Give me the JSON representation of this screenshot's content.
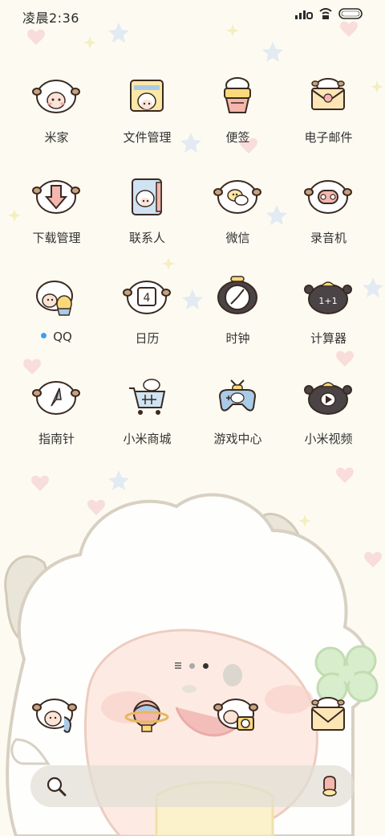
{
  "status_bar": {
    "time": "凌晨2:36",
    "icons": [
      "signal-icon",
      "hd-icon",
      "wifi-icon",
      "battery-icon"
    ]
  },
  "home_grid": {
    "apps": [
      {
        "label": "米家",
        "icon": "mi-home-icon"
      },
      {
        "label": "文件管理",
        "icon": "file-manager-icon"
      },
      {
        "label": "便签",
        "icon": "notes-icon"
      },
      {
        "label": "电子邮件",
        "icon": "email-icon"
      },
      {
        "label": "下载管理",
        "icon": "download-manager-icon"
      },
      {
        "label": "联系人",
        "icon": "contacts-icon"
      },
      {
        "label": "微信",
        "icon": "wechat-icon"
      },
      {
        "label": "录音机",
        "icon": "recorder-icon"
      },
      {
        "label": "QQ",
        "icon": "qq-icon",
        "new_install_dot": true
      },
      {
        "label": "日历",
        "icon": "calendar-icon",
        "calendar_day": "4"
      },
      {
        "label": "时钟",
        "icon": "clock-icon"
      },
      {
        "label": "计算器",
        "icon": "calculator-icon"
      },
      {
        "label": "指南针",
        "icon": "compass-icon"
      },
      {
        "label": "小米商城",
        "icon": "mi-store-icon"
      },
      {
        "label": "游戏中心",
        "icon": "game-center-icon"
      },
      {
        "label": "小米视频",
        "icon": "mi-video-icon"
      }
    ]
  },
  "page_indicator": {
    "pages": 3,
    "active_index": 2
  },
  "dock": {
    "apps": [
      {
        "icon": "phone-icon"
      },
      {
        "icon": "browser-icon"
      },
      {
        "icon": "camera-icon"
      },
      {
        "icon": "messages-icon"
      }
    ]
  },
  "search_bar": {
    "left_icon": "search-icon",
    "right_icon": "voice-assistant-icon"
  },
  "colors": {
    "wallpaper_bg": "#fdfbf1",
    "sheep_wool": "#ffffff",
    "outline": "#3a2a22",
    "horn": "#b8875e",
    "notify_dot": "#3aa0f2",
    "search_bar_bg": "#e1ded4",
    "clover": "#cfe8c2"
  }
}
